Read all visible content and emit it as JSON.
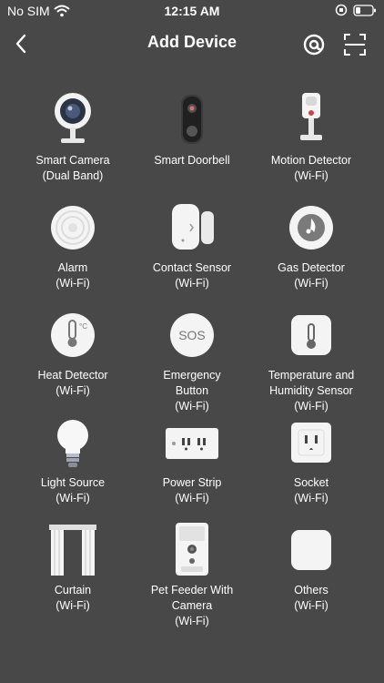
{
  "status_bar": {
    "carrier": "No SIM",
    "time": "12:15 AM"
  },
  "nav": {
    "title": "Add Device"
  },
  "devices": [
    {
      "line1": "Smart Camera",
      "line2": "(Dual Band)",
      "line3": ""
    },
    {
      "line1": "Smart Doorbell",
      "line2": "",
      "line3": ""
    },
    {
      "line1": "Motion Detector",
      "line2": "(Wi-Fi)",
      "line3": ""
    },
    {
      "line1": "Alarm",
      "line2": "(Wi-Fi)",
      "line3": ""
    },
    {
      "line1": "Contact Sensor",
      "line2": "(Wi-Fi)",
      "line3": ""
    },
    {
      "line1": "Gas Detector",
      "line2": "(Wi-Fi)",
      "line3": ""
    },
    {
      "line1": "Heat Detector",
      "line2": "(Wi-Fi)",
      "line3": ""
    },
    {
      "line1": "Emergency",
      "line2": "Button",
      "line3": "(Wi-Fi)"
    },
    {
      "line1": "Temperature and",
      "line2": "Humidity Sensor",
      "line3": "(Wi-Fi)"
    },
    {
      "line1": "Light Source",
      "line2": "(Wi-Fi)",
      "line3": ""
    },
    {
      "line1": "Power Strip",
      "line2": "(Wi-Fi)",
      "line3": ""
    },
    {
      "line1": "Socket",
      "line2": "(Wi-Fi)",
      "line3": ""
    },
    {
      "line1": "Curtain",
      "line2": "(Wi-Fi)",
      "line3": ""
    },
    {
      "line1": "Pet Feeder With",
      "line2": "Camera",
      "line3": "(Wi-Fi)"
    },
    {
      "line1": "Others",
      "line2": "(Wi-Fi)",
      "line3": ""
    }
  ],
  "icons": {
    "back": "chevron-left-icon",
    "at": "at-sign-icon",
    "scan": "scan-icon"
  },
  "emergency_text": "SOS"
}
